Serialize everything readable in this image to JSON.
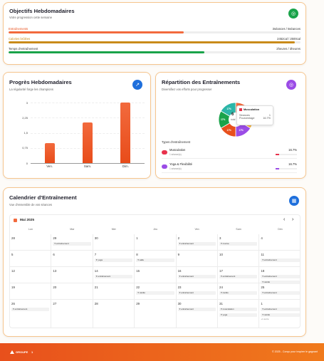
{
  "weekly": {
    "title": "Objectifs Hebdomadaires",
    "subtitle": "Votre progression cette semaine",
    "icon": "target-icon",
    "rows": [
      {
        "label": "Entraînements",
        "value": "3séances / 5séances",
        "fraction": 0.6,
        "color": "#f26a3d",
        "label_color": "#e8501c"
      },
      {
        "label": "Calories brûlées",
        "value": "2452cal / 2500cal",
        "fraction": 0.98,
        "color": "#c98b1a",
        "label_color": "#c98b1a"
      },
      {
        "label": "Temps d'entraînement",
        "value": "2heures / 3heures",
        "fraction": 0.67,
        "color": "#1aa34a",
        "label_color": "#333"
      }
    ]
  },
  "progress": {
    "title": "Progrès Hebdomadaires",
    "subtitle": "La régularité forge les champions",
    "icon": "chart-icon"
  },
  "chart_data": {
    "type": "bar",
    "categories": [
      "Ven.",
      "Sam.",
      "Dim."
    ],
    "values": [
      1,
      2,
      3
    ],
    "yticks": [
      "3",
      "2,25",
      "1,5",
      "0,75",
      "0"
    ],
    "ylim": [
      0,
      3
    ]
  },
  "repartition": {
    "title": "Répartition des Entraînements",
    "subtitle": "Diversifiez vos efforts pour progresser",
    "icon": "target-icon",
    "center_value": "6",
    "center_label": "total",
    "tooltip": {
      "title": "Musculation",
      "row1_label": "Séances",
      "row1_value": "1",
      "row2_label": "Pourcentage",
      "row2_value": "16.7%"
    },
    "slices": [
      {
        "pct": "17%",
        "color": "#f26a3d"
      },
      {
        "pct": "17%",
        "color": "#f5b53d"
      },
      {
        "pct": "17%",
        "color": "#9b4ce6"
      },
      {
        "pct": "17%",
        "color": "#e8501c"
      },
      {
        "pct": "17%",
        "color": "#1aa34a"
      },
      {
        "pct": "17%",
        "color": "#2cb6a8"
      }
    ],
    "types_label": "Types d'entraînement",
    "types": [
      {
        "name": "Musculation",
        "count": "1 séance(s)",
        "pct": "16.7%",
        "color": "#e8324c"
      },
      {
        "name": "Yoga & Flexibilité",
        "count": "1 séance(s)",
        "pct": "16.7%",
        "color": "#9b4ce6"
      }
    ]
  },
  "calendar": {
    "title": "Calendrier d'Entraînement",
    "subtitle": "Vue d'ensemble de vos séances",
    "month": "Mai 2025",
    "prev": "‹",
    "next": "›",
    "days": [
      "Lun",
      "Mar",
      "Mer",
      "Jeu",
      "Ven",
      "Sam",
      "Dim"
    ],
    "cells": [
      {
        "d": "28",
        "ev": []
      },
      {
        "d": "29",
        "ev": [
          "entraînement"
        ]
      },
      {
        "d": "30",
        "ev": []
      },
      {
        "d": "1",
        "ev": []
      },
      {
        "d": "2",
        "ev": [
          "entraînement"
        ]
      },
      {
        "d": "3",
        "ev": [
          "course"
        ]
      },
      {
        "d": "4",
        "ev": []
      },
      {
        "d": "5",
        "ev": []
      },
      {
        "d": "6",
        "ev": []
      },
      {
        "d": "7",
        "ev": [
          "yoga"
        ]
      },
      {
        "d": "8",
        "ev": [
          "salle"
        ]
      },
      {
        "d": "9",
        "ev": []
      },
      {
        "d": "10",
        "ev": []
      },
      {
        "d": "11",
        "ev": [
          "entraînement"
        ]
      },
      {
        "d": "12",
        "ev": []
      },
      {
        "d": "13",
        "ev": []
      },
      {
        "d": "14",
        "ev": [
          "entraînement"
        ]
      },
      {
        "d": "15",
        "ev": []
      },
      {
        "d": "16",
        "ev": [
          "entraînement"
        ]
      },
      {
        "d": "17",
        "ev": [
          "entraînement"
        ]
      },
      {
        "d": "18",
        "ev": [
          "entraînement",
          "cardio"
        ]
      },
      {
        "d": "19",
        "ev": []
      },
      {
        "d": "20",
        "ev": []
      },
      {
        "d": "21",
        "ev": []
      },
      {
        "d": "22",
        "ev": [
          "cardio"
        ]
      },
      {
        "d": "23",
        "ev": [
          "entraînement"
        ]
      },
      {
        "d": "24",
        "ev": [
          "cardio"
        ]
      },
      {
        "d": "25",
        "ev": [
          "entraînement"
        ]
      },
      {
        "d": "26",
        "ev": [
          "entraînement"
        ]
      },
      {
        "d": "27",
        "ev": []
      },
      {
        "d": "28",
        "ev": []
      },
      {
        "d": "29",
        "ev": []
      },
      {
        "d": "30",
        "ev": [
          "entraînement"
        ]
      },
      {
        "d": "31",
        "ev": [
          "musculation",
          "yoga"
        ]
      },
      {
        "d": "1",
        "ev": [
          "entraînement",
          "cardio"
        ],
        "more": "+1 autre"
      }
    ]
  },
  "footer": {
    "brand": "GROUPE",
    "brand_num": "1",
    "copyright": "© 2025 - Conçu pour inspirer le gagnant"
  }
}
